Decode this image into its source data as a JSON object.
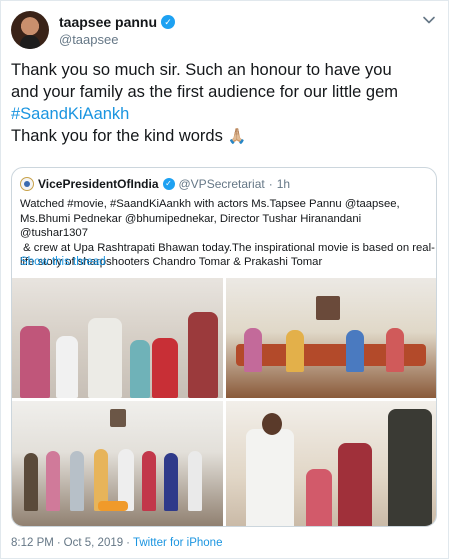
{
  "author": {
    "display_name": "taapsee pannu",
    "handle": "@taapsee",
    "verified": true
  },
  "tweet": {
    "line1": "Thank you so much sir. Such an honour to have you",
    "line2": "and your family as the first audience for our little gem",
    "hashtag": "#SaandKiAankh",
    "line4": "Thank you for the kind words",
    "emoji": "🙏🏼"
  },
  "quoted_tweet": {
    "display_name": "VicePresidentOfIndia",
    "verified": true,
    "handle": "@VPSecretariat",
    "dot": "·",
    "time": "1h",
    "text_line1": "Watched #movie, #SaandKiAankh with actors Ms.Tapsee Pannu @taapsee,",
    "text_line2": "Ms.Bhumi Pednekar @bhumipednekar, Director Tushar Hiranandani @tushar1307",
    "text_line3": " & crew at Upa Rashtrapati Bhawan today.The inspirational movie is based on real-",
    "text_line4": "life story of sharpshooters Chandro Tomar & Prakashi Tomar",
    "show_thread": "Show this thread"
  },
  "footer": {
    "time": "8:12 PM",
    "sep1": "·",
    "date": "Oct 5, 2019",
    "sep2": "·",
    "source": "Twitter for iPhone"
  },
  "colors": {
    "link": "#1b95e0",
    "verified": "#1da1f2",
    "secondary_text": "#657786",
    "border": "#ccd6dd"
  },
  "icons": [
    "verified-badge-icon",
    "chevron-down-icon",
    "folded-hands-emoji"
  ]
}
